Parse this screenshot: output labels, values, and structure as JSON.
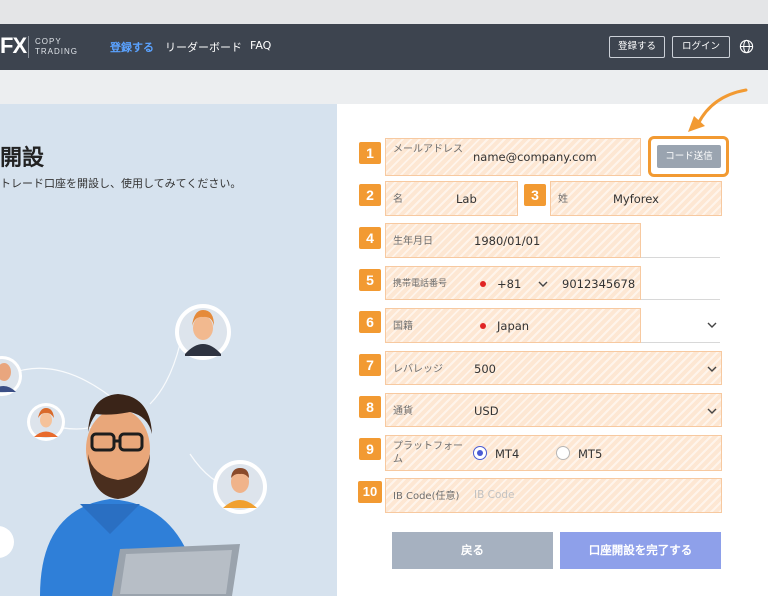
{
  "header": {
    "logo": "FX",
    "logo_sub_1": "COPY",
    "logo_sub_2": "TRADING",
    "nav": [
      "登録する",
      "リーダーボード",
      "FAQ"
    ],
    "register_button": "登録する",
    "login_button": "ログイン",
    "language_icon": "globe-icon"
  },
  "left": {
    "title": "開設",
    "description": "トレード口座を開設し、使用してみてください。"
  },
  "form": {
    "email": {
      "number": "1",
      "label": "メールアドレス",
      "value": "name@company.com"
    },
    "send_code_button": "コード送信",
    "first_name": {
      "number": "2",
      "label": "名",
      "value": "Lab"
    },
    "last_name": {
      "number": "3",
      "label": "姓",
      "value": "Myforex"
    },
    "birthdate": {
      "number": "4",
      "label": "生年月日",
      "value": "1980/01/01"
    },
    "phone": {
      "number": "5",
      "label": "携帯電話番号",
      "country_code": "+81",
      "value": "9012345678"
    },
    "nationality": {
      "number": "6",
      "label": "国籍",
      "value": "Japan"
    },
    "leverage": {
      "number": "7",
      "label": "レバレッジ",
      "value": "500"
    },
    "currency": {
      "number": "8",
      "label": "通貨",
      "value": "USD"
    },
    "platform": {
      "number": "9",
      "label": "プラットフォーム",
      "options": [
        "MT4",
        "MT5"
      ],
      "selected": "MT4"
    },
    "ib_code": {
      "number": "10",
      "label": "IB Code(任意)",
      "placeholder": "IB Code"
    },
    "back_button": "戻る",
    "submit_button": "口座開設を完了する"
  },
  "colors": {
    "navbar": "#3d444f",
    "accent_orange": "#f29a32",
    "highlight_fill": "#fde7d3",
    "submit": "#8ea0ea",
    "back": "#a6b1c0",
    "active_nav": "#5aa2ff"
  }
}
